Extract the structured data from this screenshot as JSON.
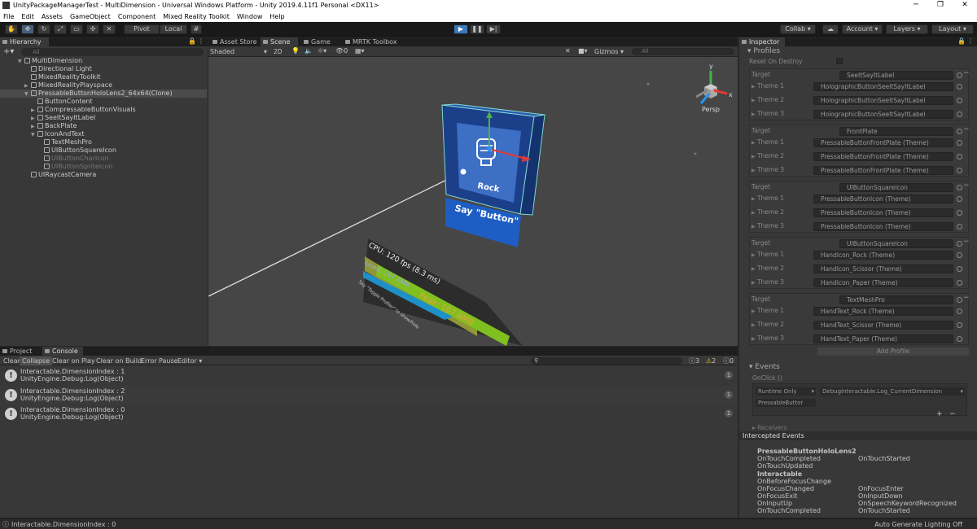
{
  "window": {
    "title": "UnityPackageManagerTest - MultiDimension - Universal Windows Platform - Unity 2019.4.11f1 Personal <DX11>",
    "min": "─",
    "max": "❐",
    "close": "✕"
  },
  "menu": [
    "File",
    "Edit",
    "Assets",
    "GameObject",
    "Component",
    "Mixed Reality Toolkit",
    "Window",
    "Help"
  ],
  "toolbar": {
    "pivot": "Pivot",
    "local": "Local",
    "collab": "Collab ▾",
    "account": "Account",
    "layers": "Layers",
    "layout": "Layout"
  },
  "hierarchy": {
    "tab": "Hierarchy",
    "search_placeholder": "All",
    "rows": [
      {
        "label": "MultiDimension",
        "indent": 0,
        "arrow": "▼",
        "kind": "scene",
        "selected": false,
        "dim": false
      },
      {
        "label": "Directional Light",
        "indent": 1,
        "arrow": "",
        "kind": "go",
        "selected": false,
        "dim": false
      },
      {
        "label": "MixedRealityToolkit",
        "indent": 1,
        "arrow": "",
        "kind": "go",
        "selected": false,
        "dim": false
      },
      {
        "label": "MixedRealityPlayspace",
        "indent": 1,
        "arrow": "▶",
        "kind": "go",
        "selected": false,
        "dim": false
      },
      {
        "label": "PressableButtonHoloLens2_64x64(Clone)",
        "indent": 1,
        "arrow": "▼",
        "kind": "go",
        "selected": true,
        "dim": false
      },
      {
        "label": "ButtonContent",
        "indent": 2,
        "arrow": "",
        "kind": "go",
        "selected": false,
        "dim": false
      },
      {
        "label": "CompressableButtonVisuals",
        "indent": 2,
        "arrow": "▶",
        "kind": "go",
        "selected": false,
        "dim": false
      },
      {
        "label": "SeeItSayItLabel",
        "indent": 2,
        "arrow": "▶",
        "kind": "go",
        "selected": false,
        "dim": false
      },
      {
        "label": "BackPlate",
        "indent": 2,
        "arrow": "▶",
        "kind": "go",
        "selected": false,
        "dim": false
      },
      {
        "label": "IconAndText",
        "indent": 2,
        "arrow": "▼",
        "kind": "go",
        "selected": false,
        "dim": false
      },
      {
        "label": "TextMeshPro",
        "indent": 3,
        "arrow": "",
        "kind": "go",
        "selected": false,
        "dim": false
      },
      {
        "label": "UIButtonSquareIcon",
        "indent": 3,
        "arrow": "",
        "kind": "go",
        "selected": false,
        "dim": false
      },
      {
        "label": "UIButtonCharIcon",
        "indent": 3,
        "arrow": "",
        "kind": "go",
        "selected": false,
        "dim": true
      },
      {
        "label": "UIButtonSpriteIcon",
        "indent": 3,
        "arrow": "",
        "kind": "go",
        "selected": false,
        "dim": true
      },
      {
        "label": "UIRaycastCamera",
        "indent": 1,
        "arrow": "",
        "kind": "go",
        "selected": false,
        "dim": false
      }
    ]
  },
  "scene": {
    "tabs": [
      "Asset Store",
      "Scene",
      "Game",
      "MRTK Toolbox"
    ],
    "active_tab": "Scene",
    "shading": "Shaded",
    "mode_2d": "2D",
    "fx_count": "0",
    "gizmos": "Gizmos",
    "search_placeholder": "All",
    "persp": "Persp",
    "axis_y": "y",
    "axis_x": "x",
    "button_text": "Rock",
    "button_label": "Say \"Button\"",
    "profiler_cpu": "CPU: 120 fps (8.3 ms)",
    "profiler_used": "Used: 167.6MB",
    "profiler_peak": "Peak: 167.8MB",
    "profiler_hint": "Say \"Toggle Profiler\" to show/hide"
  },
  "console": {
    "tabs": [
      "Project",
      "Console"
    ],
    "active_tab": "Console",
    "toolbar": [
      "Clear",
      "Collapse",
      "Clear on Play",
      "Clear on Build",
      "Error Pause",
      "Editor ▾"
    ],
    "counts": {
      "log": "3",
      "warn": "2",
      "error": "0"
    },
    "entries": [
      {
        "line1": "Interactable.DimensionIndex : 1",
        "line2": "UnityEngine.Debug:Log(Object)",
        "count": "1"
      },
      {
        "line1": "Interactable.DimensionIndex : 2",
        "line2": "UnityEngine.Debug:Log(Object)",
        "count": "1"
      },
      {
        "line1": "Interactable.DimensionIndex : 0",
        "line2": "UnityEngine.Debug:Log(Object)",
        "count": "1"
      }
    ]
  },
  "inspector": {
    "tab": "Inspector",
    "profiles_header": "Profiles",
    "reset_on_destroy": "Reset On Destroy",
    "target_label": "Target",
    "theme_labels": [
      "Theme 1",
      "Theme 2",
      "Theme 3"
    ],
    "groups": [
      {
        "target": "SeeItSayItLabel",
        "themes": [
          "HolographicButtonSeeItSayItLabel (Theme)",
          "HolographicButtonSeeItSayItLabel (Theme)",
          "HolographicButtonSeeItSayItLabel (Theme)"
        ]
      },
      {
        "target": "FrontPlate",
        "themes": [
          "PressableButtonFrontPlate (Theme)",
          "PressableButtonFrontPlate (Theme)",
          "PressableButtonFrontPlate (Theme)"
        ]
      },
      {
        "target": "UIButtonSquareIcon",
        "themes": [
          "PressableButtonIcon (Theme)",
          "PressableButtonIcon (Theme)",
          "PressableButtonIcon (Theme)"
        ]
      },
      {
        "target": "UIButtonSquareIcon",
        "themes": [
          "HandIcon_Rock (Theme)",
          "HandIcon_Scissor (Theme)",
          "HandIcon_Paper (Theme)"
        ]
      },
      {
        "target": "TextMeshPro",
        "themes": [
          "HandText_Rock (Theme)",
          "HandText_Scissor (Theme)",
          "HandText_Paper (Theme)"
        ]
      }
    ],
    "add_profile": "Add Profile",
    "events_header": "Events",
    "onclick": "OnClick ()",
    "runtime_only": "Runtime Only",
    "function": "DebugInteractable.Log_CurrentDimension",
    "object_ref": "PressableButtor",
    "receivers": "Receivers"
  },
  "intercepted": {
    "header": "Intercepted Events",
    "title1": "PressableButtonHoloLens2",
    "col1a": [
      "OnTouchCompleted",
      "OnTouchUpdated"
    ],
    "col2a": [
      "OnTouchStarted"
    ],
    "title2": "Interactable",
    "col1b": [
      "OnBeforeFocusChange",
      "OnFocusChanged",
      "OnFocusExit",
      "OnInputUp",
      "OnTouchCompleted"
    ],
    "col2b": [
      "",
      "OnFocusEnter",
      "OnInputDown",
      "OnSpeechKeywordRecognized",
      "OnTouchStarted"
    ]
  },
  "statusbar": {
    "message": "Interactable.DimensionIndex : 0",
    "right": "Auto Generate Lighting Off"
  },
  "colors": {
    "accent": "#3a79bb",
    "scene_bg": "#464646",
    "button_blue": "#1f4fa8",
    "profiler_green": "#7fbf1f",
    "profiler_orange": "#e8a33a"
  }
}
